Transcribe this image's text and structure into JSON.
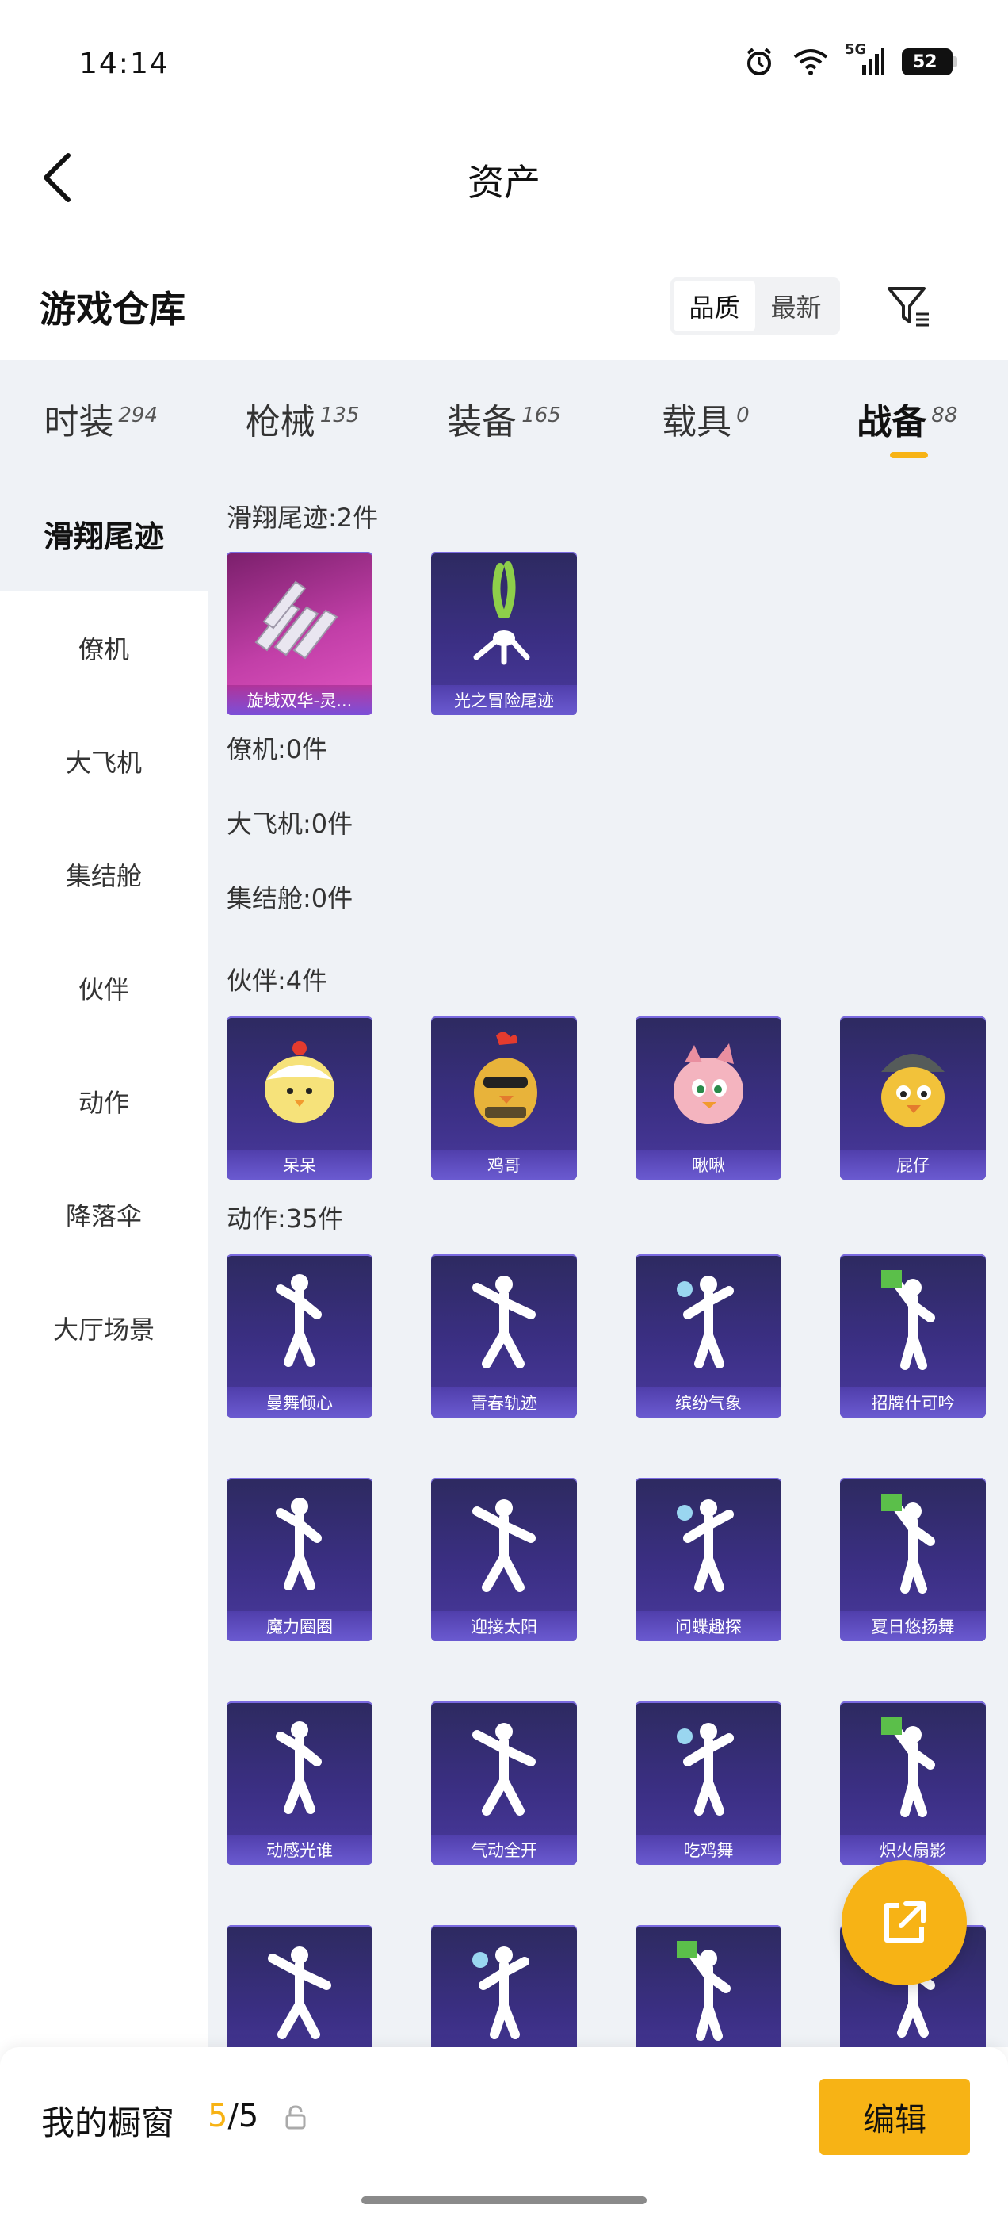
{
  "status_bar": {
    "time": "14:14",
    "network": "5G",
    "battery": "52"
  },
  "header": {
    "title": "资产"
  },
  "warehouse": {
    "title": "游戏仓库",
    "sort_options": [
      "品质",
      "最新"
    ],
    "sort_selected": "品质"
  },
  "category_tabs": [
    {
      "label": "时装",
      "count": "294"
    },
    {
      "label": "枪械",
      "count": "135"
    },
    {
      "label": "装备",
      "count": "165"
    },
    {
      "label": "载具",
      "count": "0"
    },
    {
      "label": "战备",
      "count": "88",
      "active": true
    }
  ],
  "sidebar": {
    "items": [
      {
        "label": "滑翔尾迹",
        "active": true
      },
      {
        "label": "僚机"
      },
      {
        "label": "大飞机"
      },
      {
        "label": "集结舱"
      },
      {
        "label": "伙伴"
      },
      {
        "label": "动作"
      },
      {
        "label": "降落伞"
      },
      {
        "label": "大厅场景"
      }
    ]
  },
  "sections": {
    "glide_trail": {
      "header": "滑翔尾迹:2件",
      "items": [
        "旋域双华-灵...",
        "光之冒险尾迹"
      ]
    },
    "wingman": {
      "header": "僚机:0件"
    },
    "big_plane": {
      "header": "大飞机:0件"
    },
    "gather_pod": {
      "header": "集结舱:0件"
    },
    "partner": {
      "header": "伙伴:4件",
      "items": [
        "呆呆",
        "鸡哥",
        "啾啾",
        "屁仔"
      ]
    },
    "action": {
      "header": "动作:35件",
      "items": [
        "曼舞倾心",
        "青春轨迹",
        "缤纷气象",
        "招牌什可吟",
        "魔力圈圈",
        "迎接太阳",
        "问蝶趣探",
        "夏日悠扬舞",
        "动感光谁",
        "气动全开",
        "吃鸡舞",
        "炽火扇影"
      ]
    }
  },
  "bottom_bar": {
    "label": "我的橱窗",
    "count_current": "5",
    "count_total": "/5",
    "edit_label": "编辑"
  },
  "colors": {
    "accent": "#f7b315",
    "panel": "#eff2f6",
    "card": "#3b2f84"
  }
}
